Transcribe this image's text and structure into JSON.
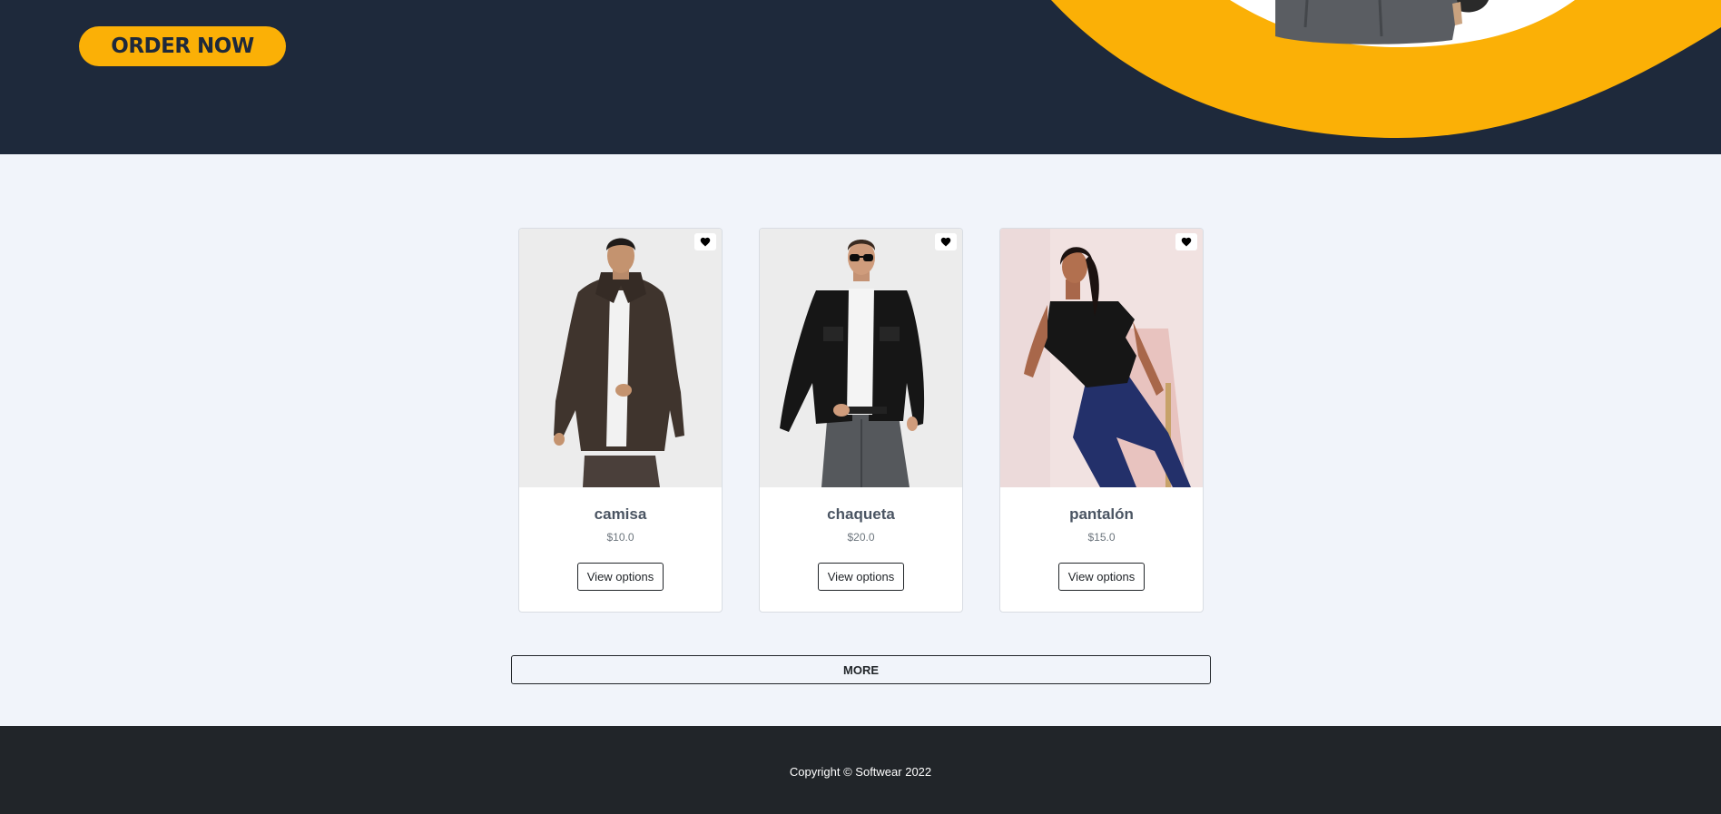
{
  "hero": {
    "order_button_label": "ORDER NOW"
  },
  "products": [
    {
      "name": "camisa",
      "price": "$10.0",
      "button_label": "View options"
    },
    {
      "name": "chaqueta",
      "price": "$20.0",
      "button_label": "View options"
    },
    {
      "name": "pantalón",
      "price": "$15.0",
      "button_label": "View options"
    }
  ],
  "more_button_label": "MORE",
  "footer": {
    "copyright": "Copyright © Softwear 2022"
  },
  "colors": {
    "hero_bg": "#1e293b",
    "accent": "#fbb006",
    "page_bg": "#f1f4fa",
    "footer_bg": "#212529"
  },
  "icons": [
    "heart-icon"
  ]
}
